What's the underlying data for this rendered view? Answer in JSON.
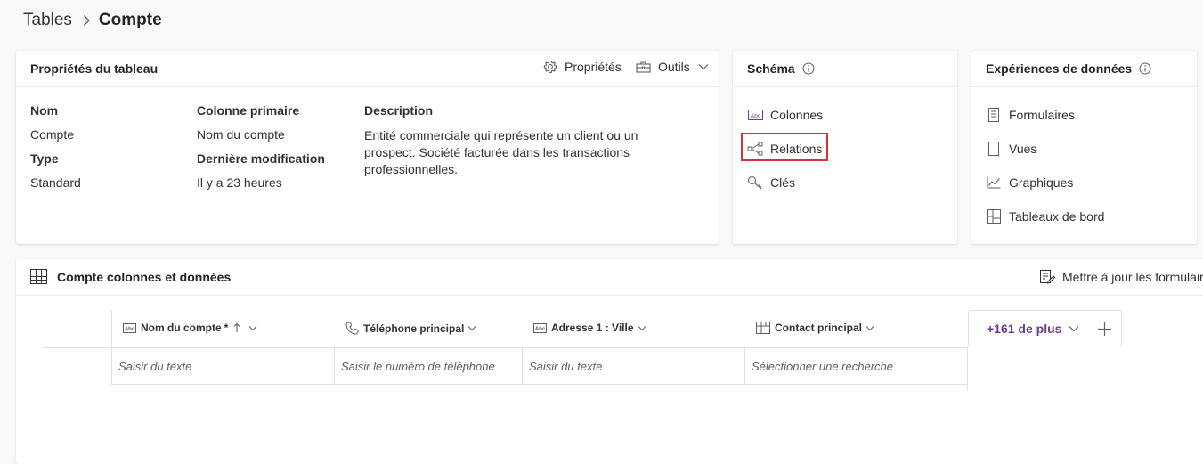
{
  "breadcrumb": {
    "root": "Tables",
    "current": "Compte"
  },
  "properties": {
    "title": "Propriétés du tableau",
    "properties_button": "Propriétés",
    "tools_button": "Outils",
    "name_label": "Nom",
    "name_value": "Compte",
    "type_label": "Type",
    "type_value": "Standard",
    "primary_column_label": "Colonne primaire",
    "primary_column_value": "Nom du compte",
    "last_modified_label": "Dernière modification",
    "last_modified_value": "Il y a 23 heures",
    "description_label": "Description",
    "description_value": "Entité commerciale qui représente un client ou un prospect. Société facturée dans les transactions professionnelles."
  },
  "schema": {
    "title": "Schéma",
    "items": [
      {
        "label": "Colonnes",
        "icon": "text-column-icon"
      },
      {
        "label": "Relations",
        "icon": "relationship-icon"
      },
      {
        "label": "Clés",
        "icon": "key-icon"
      }
    ],
    "highlight_color": "#d13438"
  },
  "experiences": {
    "title": "Expériences de données",
    "items": [
      {
        "label": "Formulaires",
        "icon": "form-icon"
      },
      {
        "label": "Vues",
        "icon": "view-icon"
      },
      {
        "label": "Graphiques",
        "icon": "chart-icon"
      },
      {
        "label": "Tableaux de bord",
        "icon": "dashboard-icon"
      }
    ]
  },
  "data_section": {
    "title": "Compte colonnes et données",
    "update_forms_button": "Mettre à jour les formulair",
    "columns": [
      {
        "label": "Nom du compte",
        "required_marker": "*",
        "placeholder": "Saisir du texte",
        "icon": "text-column-icon"
      },
      {
        "label": "Téléphone principal",
        "placeholder": "Saisir le numéro de téléphone",
        "icon": "phone-icon"
      },
      {
        "label": "Adresse 1 : Ville",
        "placeholder": "Saisir du texte",
        "icon": "text-column-icon"
      },
      {
        "label": "Contact principal",
        "placeholder": "Sélectionner une recherche",
        "icon": "lookup-icon"
      }
    ],
    "more_columns": "+161 de plus"
  },
  "colors": {
    "accent_purple": "#6b3c8a",
    "highlight_red": "#d13438"
  }
}
